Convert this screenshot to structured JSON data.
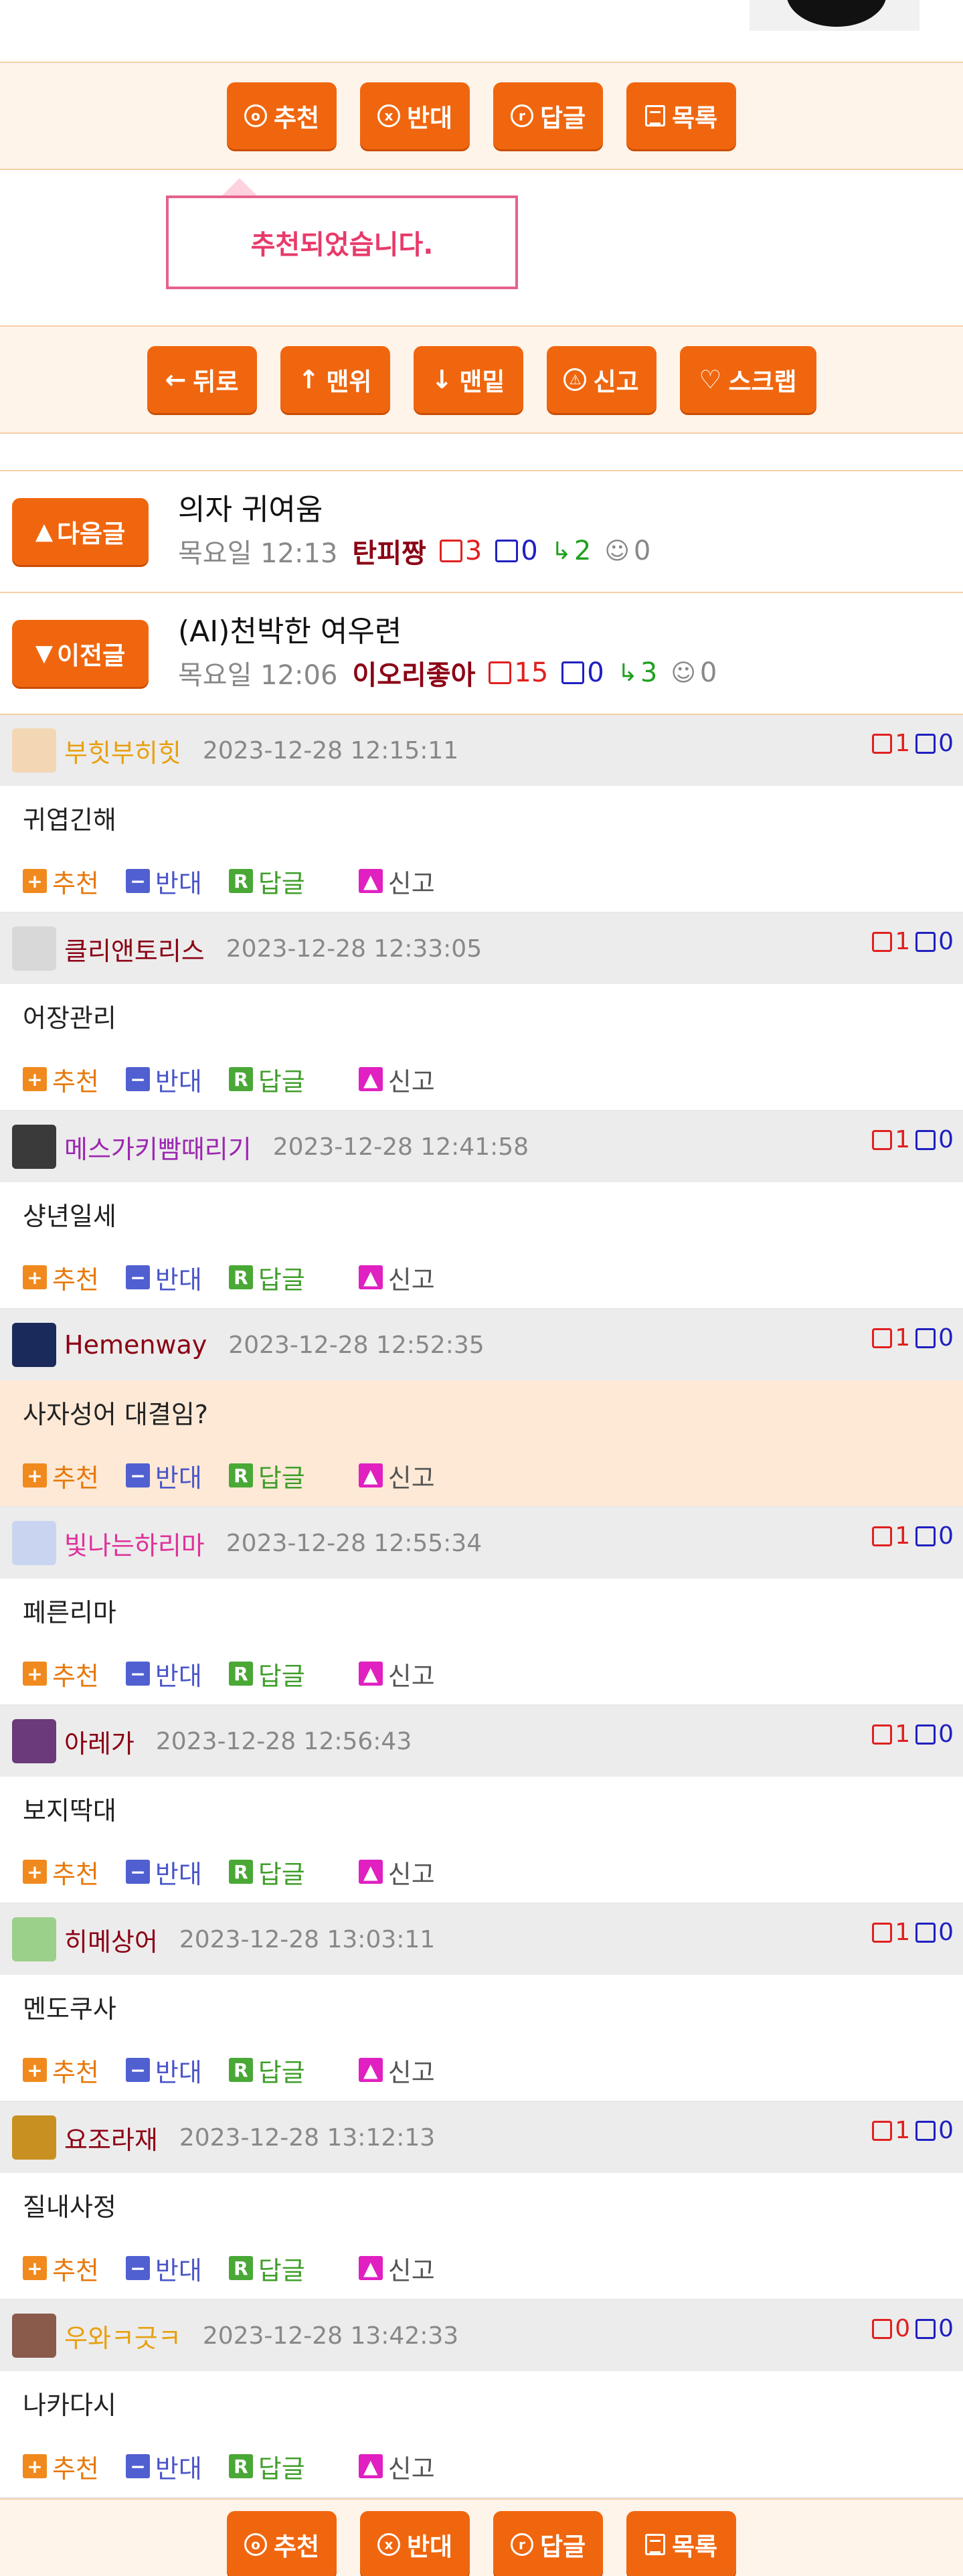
{
  "buttons_main": {
    "recommend": "추천",
    "oppose": "반대",
    "reply": "답글",
    "list": "목록"
  },
  "notice": "추천되었습니다.",
  "buttons_nav": {
    "back": "뒤로",
    "top": "맨위",
    "bottom": "맨밑",
    "report": "신고",
    "scrap": "스크랩"
  },
  "next_post": {
    "button": "다음글",
    "title": "의자 귀여움",
    "time": "목요일 12:13",
    "author": "탄피짱",
    "up": "3",
    "down": "0",
    "replies": "2",
    "views": "0"
  },
  "prev_post": {
    "button": "이전글",
    "title": "(AI)천박한 여우련",
    "time": "목요일 12:06",
    "author": "이오리좋아",
    "up": "15",
    "down": "0",
    "replies": "3",
    "views": "0"
  },
  "action_labels": {
    "recommend": "추천",
    "oppose": "반대",
    "reply": "답글",
    "report": "신고"
  },
  "comments": [
    {
      "nick": "부힛부히힛",
      "nick_color": "#e8a010",
      "date": "2023-12-28 12:15:11",
      "up": "1",
      "down": "0",
      "text": "귀엽긴해",
      "avatar": "#f3d7b4"
    },
    {
      "nick": "클리앤토리스",
      "nick_color": "#8b0014",
      "date": "2023-12-28 12:33:05",
      "up": "1",
      "down": "0",
      "text": "어장관리",
      "avatar": "#d8d8d8"
    },
    {
      "nick": "메스가키빰때리기",
      "nick_color": "#9c27b0",
      "date": "2023-12-28 12:41:58",
      "up": "1",
      "down": "0",
      "text": "샹년일세",
      "avatar": "#3a3a3a"
    },
    {
      "nick": "Hemenway",
      "nick_color": "#8b0014",
      "date": "2023-12-28 12:52:35",
      "up": "1",
      "down": "0",
      "text": "사자성어 대결임?",
      "avatar": "#1a2a5a"
    },
    {
      "nick": "빛나는하리마",
      "nick_color": "#e0309a",
      "date": "2023-12-28 12:55:34",
      "up": "1",
      "down": "0",
      "text": "페른리마",
      "avatar": "#c8d4f0"
    },
    {
      "nick": "아레가",
      "nick_color": "#8b0014",
      "date": "2023-12-28 12:56:43",
      "up": "1",
      "down": "0",
      "text": "보지딱대",
      "avatar": "#6a3a7a"
    },
    {
      "nick": "히메상어",
      "nick_color": "#8b0014",
      "date": "2023-12-28 13:03:11",
      "up": "1",
      "down": "0",
      "text": "멘도쿠사",
      "avatar": "#9ad08a"
    },
    {
      "nick": "요조라재",
      "nick_color": "#8b0014",
      "date": "2023-12-28 13:12:13",
      "up": "1",
      "down": "0",
      "text": "질내사정",
      "avatar": "#c89020"
    },
    {
      "nick": "우와ㅋ긋ㅋ",
      "nick_color": "#e8a010",
      "date": "2023-12-28 13:42:33",
      "up": "0",
      "down": "0",
      "text": "나카다시",
      "avatar": "#8a5a4a"
    }
  ],
  "colors": {
    "accent": "#f0660e",
    "notice": "#e83a6a",
    "up": "#e02020",
    "down": "#2020c0"
  }
}
